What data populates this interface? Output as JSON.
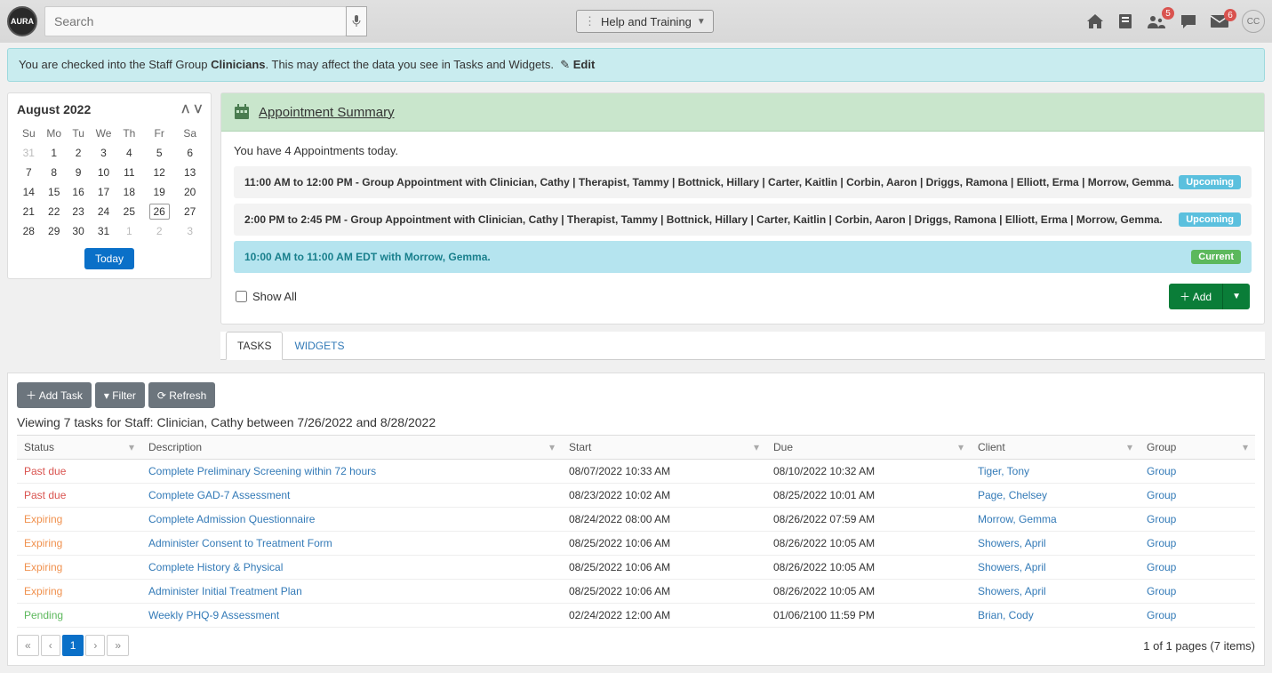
{
  "logo_text": "AURA",
  "search": {
    "placeholder": "Search"
  },
  "help_dropdown": "Help and Training",
  "top_badges": {
    "person": "5",
    "envelope": "6"
  },
  "avatar": "CC",
  "banner": {
    "prefix": "You are checked into the Staff Group ",
    "group": "Clinicians",
    "suffix": ". This may affect the data you see in Tasks and Widgets.",
    "edit": "Edit"
  },
  "calendar": {
    "month": "August 2022",
    "days": [
      "Su",
      "Mo",
      "Tu",
      "We",
      "Th",
      "Fr",
      "Sa"
    ],
    "weeks": [
      [
        {
          "d": "31",
          "m": true
        },
        {
          "d": "1"
        },
        {
          "d": "2"
        },
        {
          "d": "3"
        },
        {
          "d": "4"
        },
        {
          "d": "5"
        },
        {
          "d": "6"
        }
      ],
      [
        {
          "d": "7"
        },
        {
          "d": "8"
        },
        {
          "d": "9"
        },
        {
          "d": "10"
        },
        {
          "d": "11"
        },
        {
          "d": "12"
        },
        {
          "d": "13"
        }
      ],
      [
        {
          "d": "14"
        },
        {
          "d": "15"
        },
        {
          "d": "16"
        },
        {
          "d": "17"
        },
        {
          "d": "18"
        },
        {
          "d": "19"
        },
        {
          "d": "20"
        }
      ],
      [
        {
          "d": "21"
        },
        {
          "d": "22"
        },
        {
          "d": "23"
        },
        {
          "d": "24"
        },
        {
          "d": "25"
        },
        {
          "d": "26",
          "sel": true
        },
        {
          "d": "27"
        }
      ],
      [
        {
          "d": "28"
        },
        {
          "d": "29"
        },
        {
          "d": "30"
        },
        {
          "d": "31"
        },
        {
          "d": "1",
          "m": true
        },
        {
          "d": "2",
          "m": true
        },
        {
          "d": "3",
          "m": true
        }
      ]
    ],
    "today_btn": "Today"
  },
  "appt": {
    "title": "Appointment Summary",
    "count_text": "You have 4 Appointments today.",
    "rows": [
      {
        "text": "11:00 AM to 12:00 PM - Group Appointment with Clinician, Cathy | Therapist, Tammy | Bottnick, Hillary | Carter, Kaitlin | Corbin, Aaron | Driggs, Ramona | Elliott, Erma | Morrow, Gemma.",
        "badge": "Upcoming",
        "type": "upcoming"
      },
      {
        "text": "2:00 PM to 2:45 PM - Group Appointment with Clinician, Cathy | Therapist, Tammy | Bottnick, Hillary | Carter, Kaitlin | Corbin, Aaron | Driggs, Ramona | Elliott, Erma | Morrow, Gemma.",
        "badge": "Upcoming",
        "type": "upcoming"
      },
      {
        "text": "10:00 AM to 11:00 AM EDT with Morrow, Gemma.",
        "badge": "Current",
        "type": "current"
      }
    ],
    "show_all": "Show All",
    "add_btn": "Add"
  },
  "tabs": {
    "tasks": "TASKS",
    "widgets": "WIDGETS"
  },
  "task_toolbar": {
    "add": "Add Task",
    "filter": "Filter",
    "refresh": "Refresh"
  },
  "task_viewing": "Viewing 7 tasks for Staff: Clinician, Cathy between 7/26/2022 and 8/28/2022",
  "task_headers": {
    "status": "Status",
    "desc": "Description",
    "start": "Start",
    "due": "Due",
    "client": "Client",
    "group": "Group"
  },
  "tasks": [
    {
      "status": "Past due",
      "scls": "status-past",
      "desc": "Complete Preliminary Screening within 72 hours",
      "start": "08/07/2022 10:33 AM",
      "due": "08/10/2022 10:32 AM",
      "client": "Tiger, Tony",
      "group": "Group"
    },
    {
      "status": "Past due",
      "scls": "status-past",
      "desc": "Complete GAD-7 Assessment",
      "start": "08/23/2022 10:02 AM",
      "due": "08/25/2022 10:01 AM",
      "client": "Page, Chelsey",
      "group": "Group"
    },
    {
      "status": "Expiring",
      "scls": "status-exp",
      "desc": "Complete Admission Questionnaire",
      "start": "08/24/2022 08:00 AM",
      "due": "08/26/2022 07:59 AM",
      "client": "Morrow, Gemma",
      "group": "Group"
    },
    {
      "status": "Expiring",
      "scls": "status-exp",
      "desc": "Administer Consent to Treatment Form",
      "start": "08/25/2022 10:06 AM",
      "due": "08/26/2022 10:05 AM",
      "client": "Showers, April",
      "group": "Group"
    },
    {
      "status": "Expiring",
      "scls": "status-exp",
      "desc": "Complete History & Physical",
      "start": "08/25/2022 10:06 AM",
      "due": "08/26/2022 10:05 AM",
      "client": "Showers, April",
      "group": "Group"
    },
    {
      "status": "Expiring",
      "scls": "status-exp",
      "desc": "Administer Initial Treatment Plan",
      "start": "08/25/2022 10:06 AM",
      "due": "08/26/2022 10:05 AM",
      "client": "Showers, April",
      "group": "Group"
    },
    {
      "status": "Pending",
      "scls": "status-pend",
      "desc": "Weekly PHQ-9 Assessment",
      "start": "02/24/2022 12:00 AM",
      "due": "01/06/2100 11:59 PM",
      "client": "Brian, Cody",
      "group": "Group"
    }
  ],
  "pager": {
    "page": "1",
    "info": "1 of 1 pages (7 items)"
  }
}
